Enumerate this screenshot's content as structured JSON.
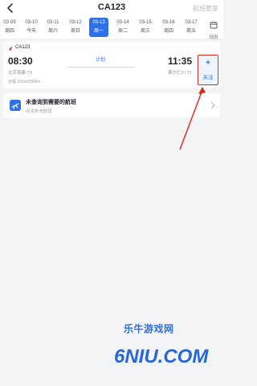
{
  "header": {
    "title": "CA123",
    "right_link": "航班管家"
  },
  "dates": [
    {
      "date": "03-09",
      "weekday": "周四"
    },
    {
      "date": "03-10",
      "weekday": "今天"
    },
    {
      "date": "03-11",
      "weekday": "周六"
    },
    {
      "date": "03-12",
      "weekday": "周日"
    },
    {
      "date": "03-13",
      "weekday": "周一",
      "active": true
    },
    {
      "date": "03-14",
      "weekday": "周二"
    },
    {
      "date": "03-15",
      "weekday": "周三"
    },
    {
      "date": "03-16",
      "weekday": "周四"
    },
    {
      "date": "03-17",
      "weekday": "周五"
    }
  ],
  "calendar_label": "日历",
  "flight": {
    "number": "CA123",
    "dep_time": "08:30",
    "arr_time": "11:35",
    "status": "计划",
    "dep_airport": "北京首都 T3",
    "arr_airport": "首尔仁川 T1",
    "meta": "全程 2h5m/958km",
    "follow_label": "关注",
    "follow_symbol": "+"
  },
  "not_found": {
    "title": "未查询到需要的航班",
    "subtitle": "点击补充航班"
  },
  "watermark": {
    "brand": "乐牛游戏网",
    "domain": "6NIU.COM"
  },
  "colors": {
    "accent": "#2f6fe7",
    "highlight": "#e0241a",
    "airline": "#d4252c"
  },
  "icons": [
    "back-arrow-icon",
    "calendar-icon",
    "airline-logo-icon",
    "add-flight-icon",
    "chevron-right-icon"
  ]
}
